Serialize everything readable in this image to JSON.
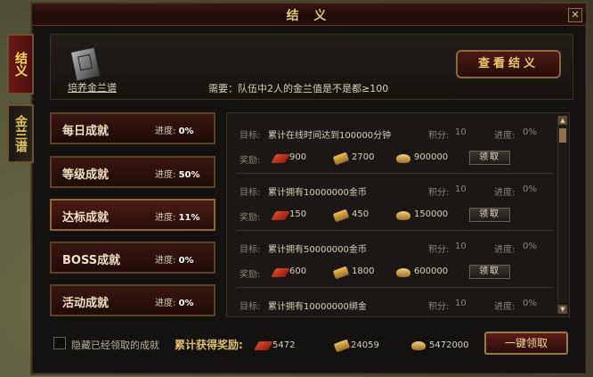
{
  "window": {
    "title": "结 义",
    "close_glyph": "✕"
  },
  "side_tabs": [
    {
      "label": "结义"
    },
    {
      "label": "金兰谱"
    }
  ],
  "header": {
    "book_label": "培养金兰谱",
    "requirement": "需要：队伍中2人的金兰值是不是都≥100",
    "view_button": "查看结义"
  },
  "categories": [
    {
      "name": "每日成就",
      "progress_label": "进度:",
      "progress": "0%"
    },
    {
      "name": "等级成就",
      "progress_label": "进度:",
      "progress": "50%"
    },
    {
      "name": "达标成就",
      "progress_label": "进度:",
      "progress": "11%"
    },
    {
      "name": "BOSS成就",
      "progress_label": "进度:",
      "progress": "0%"
    },
    {
      "name": "活动成就",
      "progress_label": "进度:",
      "progress": "0%"
    }
  ],
  "list": {
    "target_label": "目标:",
    "reward_label": "奖励:",
    "points_label": "积分:",
    "progress_label": "进度:",
    "claim_label": "领取",
    "rows": [
      {
        "target": "累计在线时间达到100000分钟",
        "points": "10",
        "progress": "0%",
        "r1": "900",
        "r2": "2700",
        "r3": "900000"
      },
      {
        "target": "累计拥有10000000金币",
        "points": "10",
        "progress": "0%",
        "r1": "150",
        "r2": "450",
        "r3": "150000"
      },
      {
        "target": "累计拥有50000000金币",
        "points": "10",
        "progress": "0%",
        "r1": "600",
        "r2": "1800",
        "r3": "600000"
      },
      {
        "target": "累计拥有10000000绑金",
        "points": "10",
        "progress": "0%"
      }
    ]
  },
  "footer": {
    "hide_label": "隐藏已经领取的成就",
    "total_label": "累计获得奖励:",
    "total1": "5472",
    "total2": "24059",
    "total3": "5472000",
    "claim_all": "一键领取"
  }
}
